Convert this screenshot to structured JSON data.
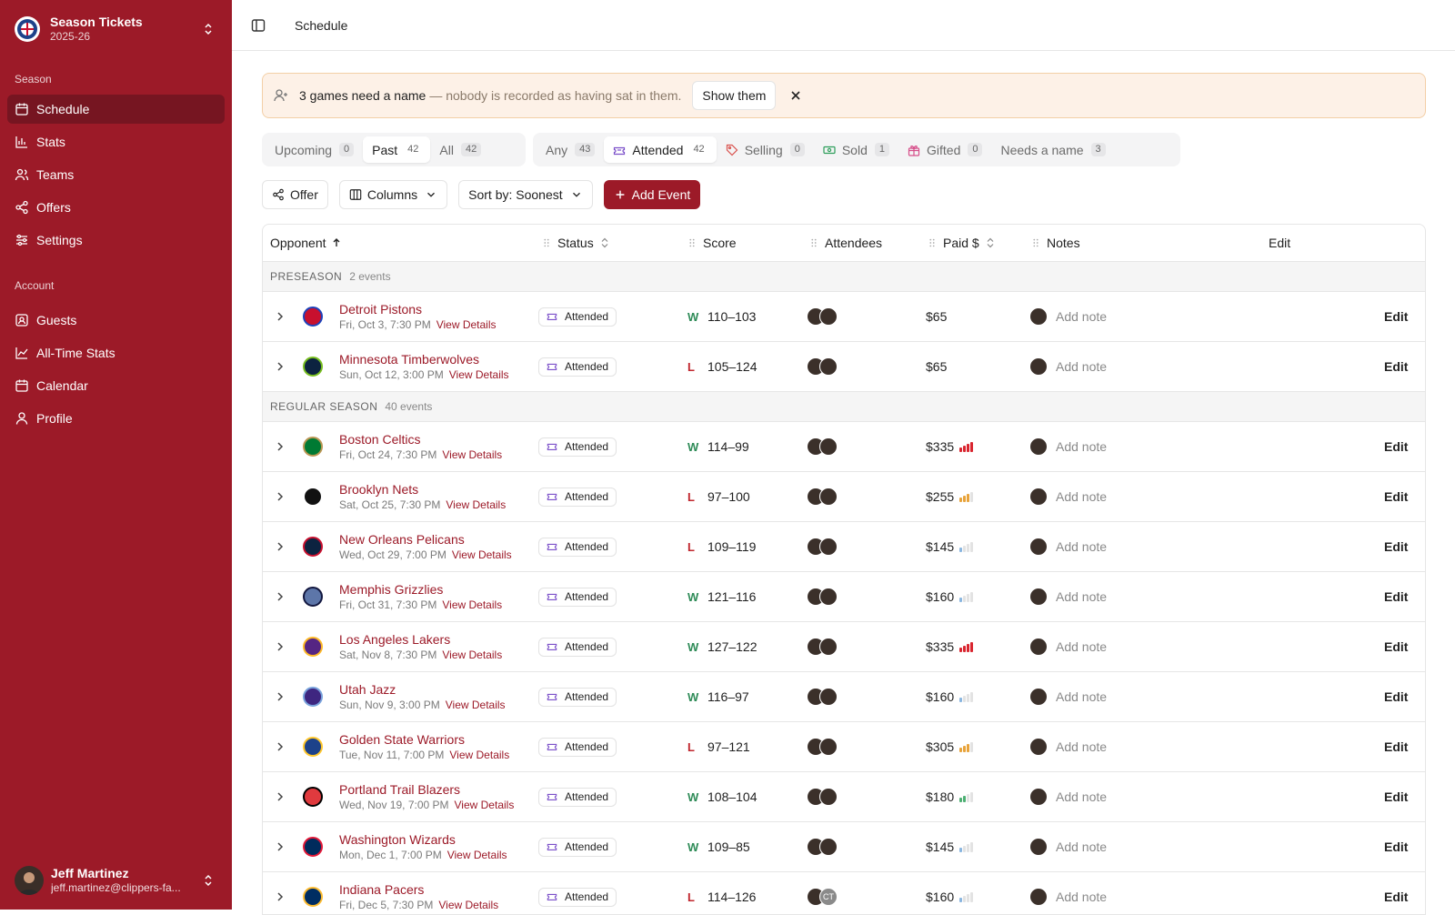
{
  "workspace": {
    "name": "Season Tickets",
    "season": "2025-26"
  },
  "nav": {
    "season_label": "Season",
    "season_items": [
      {
        "label": "Schedule",
        "icon": "calendar-icon",
        "active": true
      },
      {
        "label": "Stats",
        "icon": "bar-chart-icon"
      },
      {
        "label": "Teams",
        "icon": "users-icon"
      },
      {
        "label": "Offers",
        "icon": "share-icon"
      },
      {
        "label": "Settings",
        "icon": "sliders-icon"
      }
    ],
    "account_label": "Account",
    "account_items": [
      {
        "label": "Guests",
        "icon": "contact-icon"
      },
      {
        "label": "All-Time Stats",
        "icon": "line-chart-icon"
      },
      {
        "label": "Calendar",
        "icon": "calendar-icon"
      },
      {
        "label": "Profile",
        "icon": "user-icon"
      }
    ]
  },
  "user": {
    "name": "Jeff Martinez",
    "email": "jeff.martinez@clippers-fa..."
  },
  "topbar": {
    "title": "Schedule"
  },
  "banner": {
    "strong": "3 games need a name",
    "muted": "— nobody is recorded as having sat in them.",
    "button": "Show them"
  },
  "time_filter": [
    {
      "label": "Upcoming",
      "count": "0",
      "on": false
    },
    {
      "label": "Past",
      "count": "42",
      "on": true
    },
    {
      "label": "All",
      "count": "42",
      "on": false
    }
  ],
  "status_filter": [
    {
      "label": "Any",
      "count": "43",
      "on": false,
      "icon": ""
    },
    {
      "label": "Attended",
      "count": "42",
      "on": true,
      "icon": "ticket-icon"
    },
    {
      "label": "Selling",
      "count": "0",
      "on": false,
      "icon": "tag-icon"
    },
    {
      "label": "Sold",
      "count": "1",
      "on": false,
      "icon": "cash-icon"
    },
    {
      "label": "Gifted",
      "count": "0",
      "on": false,
      "icon": "gift-icon"
    },
    {
      "label": "Needs a name",
      "count": "3",
      "on": false,
      "icon": ""
    }
  ],
  "toolbar": {
    "offer": "Offer",
    "columns": "Columns",
    "sort": "Sort by: Soonest",
    "add": "Add Event"
  },
  "columns": {
    "opponent": "Opponent",
    "status": "Status",
    "score": "Score",
    "attendees": "Attendees",
    "paid": "Paid $",
    "notes": "Notes",
    "edit": "Edit"
  },
  "colors": {
    "accent": "#9c1a28",
    "win": "#2e8b57",
    "loss": "#c0262d"
  },
  "row_labels": {
    "view_details": "View Details",
    "add_note": "Add note",
    "edit": "Edit"
  },
  "groups": [
    {
      "name": "PRESEASON",
      "count": "2 events",
      "rows": [
        {
          "opponent": "Detroit Pistons",
          "date": "Fri, Oct 3, 7:30 PM",
          "status": "Attended",
          "result": "W",
          "score": "110–103",
          "paid": "$65",
          "price_level": 0,
          "logo_color": "#c8102e",
          "logo_fg": "#1d42ba",
          "attendees": [
            "",
            ""
          ]
        },
        {
          "opponent": "Minnesota Timberwolves",
          "date": "Sun, Oct 12, 3:00 PM",
          "status": "Attended",
          "result": "L",
          "score": "105–124",
          "paid": "$65",
          "price_level": 0,
          "logo_color": "#0c2340",
          "logo_fg": "#78be20",
          "attendees": [
            "",
            ""
          ]
        }
      ]
    },
    {
      "name": "REGULAR SEASON",
      "count": "40 events",
      "rows": [
        {
          "opponent": "Boston Celtics",
          "date": "Fri, Oct 24, 7:30 PM",
          "status": "Attended",
          "result": "W",
          "score": "114–99",
          "paid": "$335",
          "price_level": 4,
          "logo_color": "#007a33",
          "logo_fg": "#ba9653",
          "attendees": [
            "",
            ""
          ]
        },
        {
          "opponent": "Brooklyn Nets",
          "date": "Sat, Oct 25, 7:30 PM",
          "status": "Attended",
          "result": "L",
          "score": "97–100",
          "paid": "$255",
          "price_level": 3,
          "logo_color": "#111111",
          "logo_fg": "#ffffff",
          "attendees": [
            "",
            ""
          ]
        },
        {
          "opponent": "New Orleans Pelicans",
          "date": "Wed, Oct 29, 7:00 PM",
          "status": "Attended",
          "result": "L",
          "score": "109–119",
          "paid": "$145",
          "price_level": 1,
          "logo_color": "#0c2340",
          "logo_fg": "#c8102e",
          "attendees": [
            "",
            ""
          ]
        },
        {
          "opponent": "Memphis Grizzlies",
          "date": "Fri, Oct 31, 7:30 PM",
          "status": "Attended",
          "result": "W",
          "score": "121–116",
          "paid": "$160",
          "price_level": 1,
          "logo_color": "#5d76a9",
          "logo_fg": "#12173f",
          "attendees": [
            "",
            ""
          ]
        },
        {
          "opponent": "Los Angeles Lakers",
          "date": "Sat, Nov 8, 7:30 PM",
          "status": "Attended",
          "result": "W",
          "score": "127–122",
          "paid": "$335",
          "price_level": 4,
          "logo_color": "#552583",
          "logo_fg": "#fdb927",
          "attendees": [
            "",
            ""
          ]
        },
        {
          "opponent": "Utah Jazz",
          "date": "Sun, Nov 9, 3:00 PM",
          "status": "Attended",
          "result": "W",
          "score": "116–97",
          "paid": "$160",
          "price_level": 1,
          "logo_color": "#3e2680",
          "logo_fg": "#79a3dc",
          "attendees": [
            "",
            ""
          ]
        },
        {
          "opponent": "Golden State Warriors",
          "date": "Tue, Nov 11, 7:00 PM",
          "status": "Attended",
          "result": "L",
          "score": "97–121",
          "paid": "$305",
          "price_level": 3,
          "logo_color": "#1d428a",
          "logo_fg": "#ffc72c",
          "attendees": [
            "",
            ""
          ]
        },
        {
          "opponent": "Portland Trail Blazers",
          "date": "Wed, Nov 19, 7:00 PM",
          "status": "Attended",
          "result": "W",
          "score": "108–104",
          "paid": "$180",
          "price_level": 2,
          "logo_color": "#e03a3e",
          "logo_fg": "#000000",
          "attendees": [
            "",
            ""
          ]
        },
        {
          "opponent": "Washington Wizards",
          "date": "Mon, Dec 1, 7:00 PM",
          "status": "Attended",
          "result": "W",
          "score": "109–85",
          "paid": "$145",
          "price_level": 1,
          "logo_color": "#002b5c",
          "logo_fg": "#e31837",
          "attendees": [
            "",
            ""
          ]
        },
        {
          "opponent": "Indiana Pacers",
          "date": "Fri, Dec 5, 7:30 PM",
          "status": "Attended",
          "result": "L",
          "score": "114–126",
          "paid": "$160",
          "price_level": 1,
          "logo_color": "#002d62",
          "logo_fg": "#fdbb30",
          "attendees": [
            "",
            "CT"
          ]
        }
      ]
    }
  ]
}
